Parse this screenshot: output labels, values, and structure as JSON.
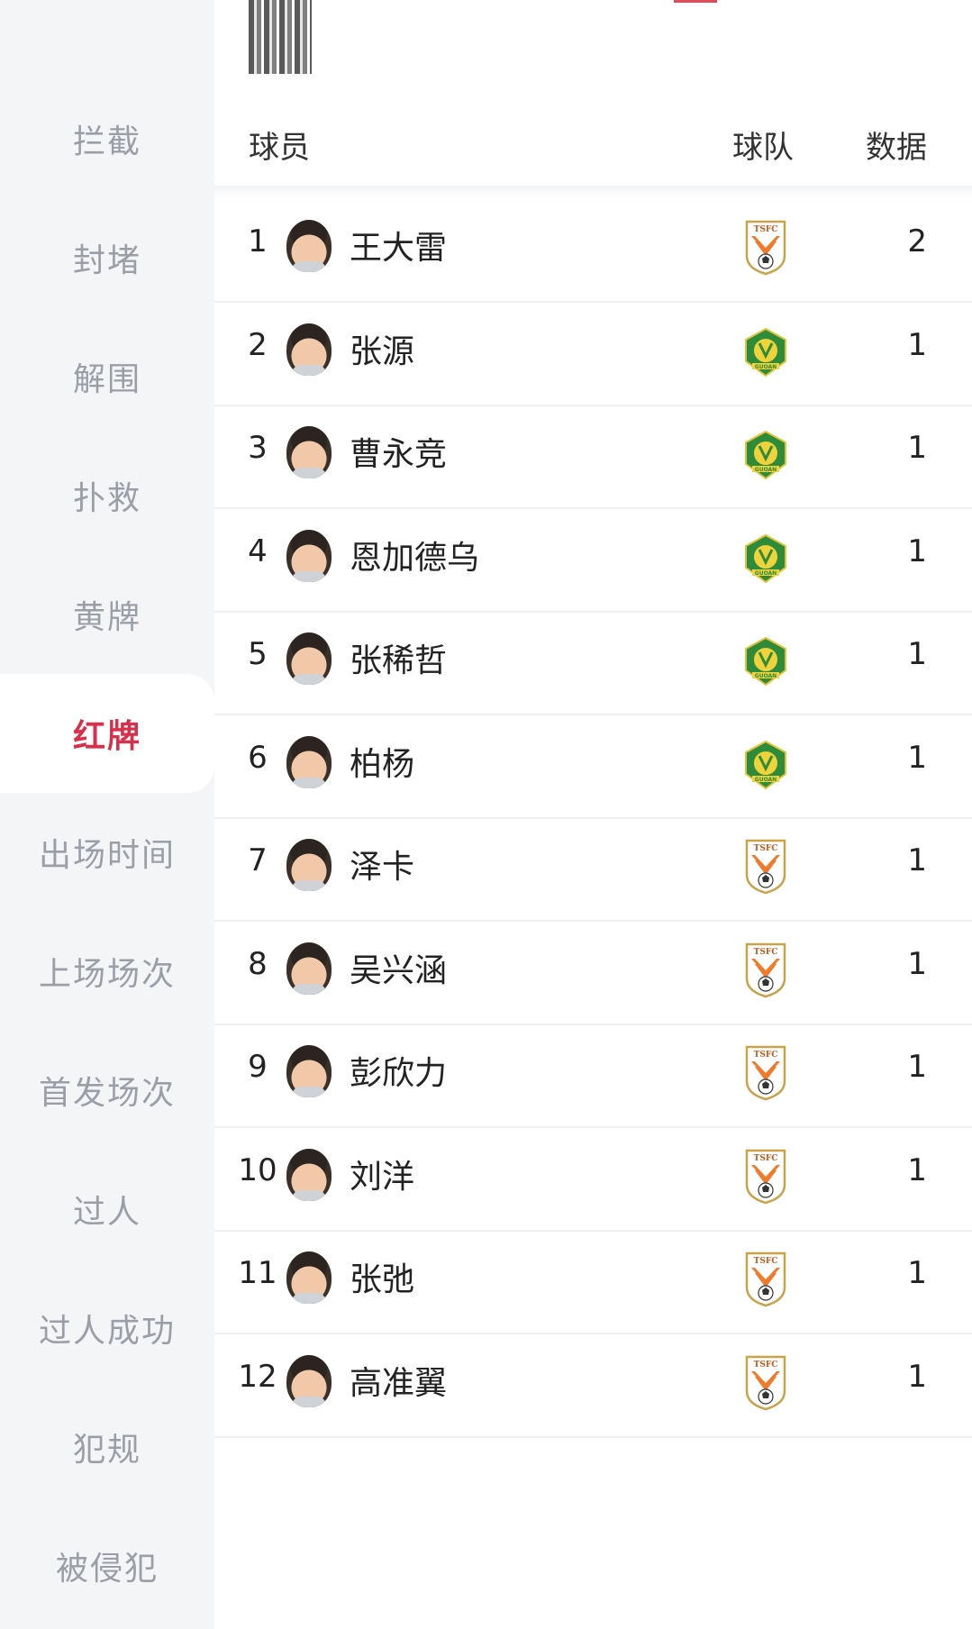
{
  "sidebar": {
    "items": [
      {
        "label": "拦截"
      },
      {
        "label": "封堵"
      },
      {
        "label": "解围"
      },
      {
        "label": "扑救"
      },
      {
        "label": "黄牌"
      },
      {
        "label": "红牌",
        "active": true
      },
      {
        "label": "出场时间"
      },
      {
        "label": "上场场次"
      },
      {
        "label": "首发场次"
      },
      {
        "label": "过人"
      },
      {
        "label": "过人成功"
      },
      {
        "label": "犯规"
      },
      {
        "label": "被侵犯"
      }
    ],
    "active_color": "#d8304a"
  },
  "table": {
    "headers": {
      "player": "球员",
      "team": "球队",
      "data": "数据"
    },
    "rows": [
      {
        "rank": "1",
        "name": "王大雷",
        "team": "TSFC",
        "value": "2"
      },
      {
        "rank": "2",
        "name": "张源",
        "team": "GUOAN",
        "value": "1"
      },
      {
        "rank": "3",
        "name": "曹永竞",
        "team": "GUOAN",
        "value": "1"
      },
      {
        "rank": "4",
        "name": "恩加德乌",
        "team": "GUOAN",
        "value": "1"
      },
      {
        "rank": "5",
        "name": "张稀哲",
        "team": "GUOAN",
        "value": "1"
      },
      {
        "rank": "6",
        "name": "柏杨",
        "team": "GUOAN",
        "value": "1"
      },
      {
        "rank": "7",
        "name": "泽卡",
        "team": "TSFC",
        "value": "1"
      },
      {
        "rank": "8",
        "name": "吴兴涵",
        "team": "TSFC",
        "value": "1"
      },
      {
        "rank": "9",
        "name": "彭欣力",
        "team": "TSFC",
        "value": "1"
      },
      {
        "rank": "10",
        "name": "刘洋",
        "team": "TSFC",
        "value": "1"
      },
      {
        "rank": "11",
        "name": "张弛",
        "team": "TSFC",
        "value": "1"
      },
      {
        "rank": "12",
        "name": "高准翼",
        "team": "TSFC",
        "value": "1"
      }
    ]
  }
}
